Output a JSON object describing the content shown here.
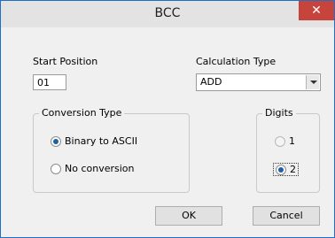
{
  "window": {
    "title": "BCC",
    "close_glyph": "✕"
  },
  "start_position": {
    "label": "Start Position",
    "value": "01"
  },
  "calculation_type": {
    "label": "Calculation Type",
    "selected": "ADD"
  },
  "conversion_type": {
    "label": "Conversion Type",
    "options": [
      {
        "label": "Binary to ASCII",
        "checked": true
      },
      {
        "label": "No conversion",
        "checked": false
      }
    ]
  },
  "digits": {
    "label": "Digits",
    "options": [
      {
        "label": "1",
        "checked": false
      },
      {
        "label": "2",
        "checked": true
      }
    ]
  },
  "buttons": {
    "ok": "OK",
    "cancel": "Cancel"
  },
  "colors": {
    "accent": "#1e6fc8",
    "close": "#c7443c",
    "radio_dot": "#1f5fa8"
  },
  "icons": {
    "close": "close-icon",
    "dropdown": "chevron-down-icon"
  }
}
